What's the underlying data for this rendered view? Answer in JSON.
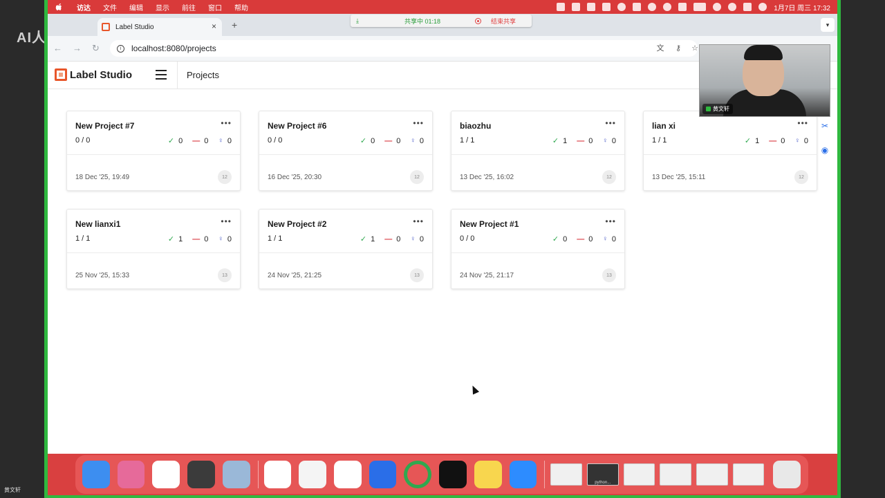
{
  "overlay": {
    "watermark": "AI人工智能",
    "presenter_corner": "黄文轩"
  },
  "menubar": {
    "items": [
      "访达",
      "文件",
      "编辑",
      "显示",
      "前往",
      "窗口",
      "帮助"
    ],
    "clock": "1月7日 周三 17:32"
  },
  "share_bar": {
    "status": "共享中 01:18",
    "stop_label": "结束共享"
  },
  "browser": {
    "tab_title": "Label Studio",
    "tab_close": "×",
    "new_tab": "+",
    "url": "localhost:8080/projects"
  },
  "app": {
    "logo_text": "Label Studio",
    "page_title": "Projects",
    "accent_color": "#e8562a"
  },
  "projects": [
    {
      "title": "New Project #7",
      "ratio": "0 / 0",
      "completed": "0",
      "skipped": "0",
      "predictions": "0",
      "date": "18 Dec '25, 19:49",
      "badge": "12"
    },
    {
      "title": "New Project #6",
      "ratio": "0 / 0",
      "completed": "0",
      "skipped": "0",
      "predictions": "0",
      "date": "16 Dec '25, 20:30",
      "badge": "12"
    },
    {
      "title": "biaozhu",
      "ratio": "1 / 1",
      "completed": "1",
      "skipped": "0",
      "predictions": "0",
      "date": "13 Dec '25, 16:02",
      "badge": "12"
    },
    {
      "title": "lian xi",
      "ratio": "1 / 1",
      "completed": "1",
      "skipped": "0",
      "predictions": "0",
      "date": "13 Dec '25, 15:11",
      "badge": "12"
    },
    {
      "title": "New lianxi1",
      "ratio": "1 / 1",
      "completed": "1",
      "skipped": "0",
      "predictions": "0",
      "date": "25 Nov '25, 15:33",
      "badge": "13"
    },
    {
      "title": "New Project #2",
      "ratio": "1 / 1",
      "completed": "1",
      "skipped": "0",
      "predictions": "0",
      "date": "24 Nov '25, 21:25",
      "badge": "13"
    },
    {
      "title": "New Project #1",
      "ratio": "0 / 0",
      "completed": "0",
      "skipped": "0",
      "predictions": "0",
      "date": "24 Nov '25, 21:17",
      "badge": "13"
    }
  ],
  "card_icons": {
    "more": "•••",
    "completed": "✓",
    "skipped": "—",
    "predictions": "♀"
  },
  "video": {
    "name": "黄文轩"
  },
  "dock": {
    "apps": [
      {
        "name": "finder-app",
        "color": "#3d8ef0"
      },
      {
        "name": "launchpad-app",
        "color": "#e66a9a"
      },
      {
        "name": "chrome-app",
        "color": "#ffffff"
      },
      {
        "name": "sublime-app",
        "color": "#3b3b3b"
      },
      {
        "name": "preview-app",
        "color": "#9ab8d8"
      },
      {
        "name": "baidu-netdisk-app",
        "color": "#ffffff"
      },
      {
        "name": "textedit-app",
        "color": "#f4f4f4"
      },
      {
        "name": "wps-app",
        "color": "#ffffff"
      },
      {
        "name": "feishu-app",
        "color": "#2a6ee8"
      },
      {
        "name": "record-app",
        "color": "#2fa84f"
      },
      {
        "name": "terminal-app",
        "color": "#111111"
      },
      {
        "name": "notes-app",
        "color": "#f8d64e"
      },
      {
        "name": "zoom-app",
        "color": "#2d8cff"
      }
    ],
    "window_label": "python..."
  }
}
